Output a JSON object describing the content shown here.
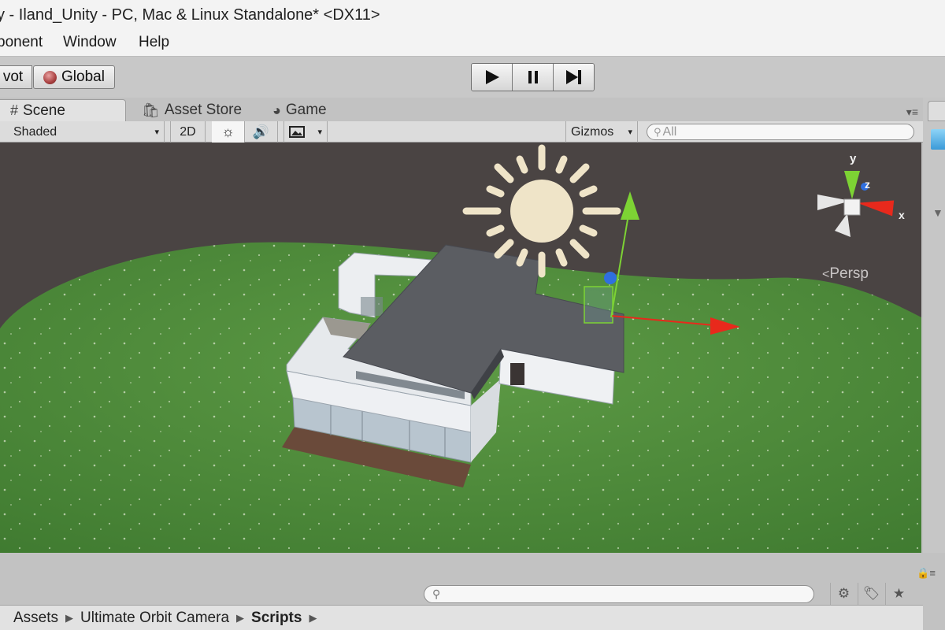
{
  "window": {
    "title": "y - Iland_Unity - PC, Mac & Linux Standalone* <DX11>"
  },
  "menu": {
    "items": [
      "ponent",
      "Window",
      "Help"
    ]
  },
  "toolbar": {
    "pivot_label": "vot",
    "global_label": "Global",
    "play_icon": "play-icon",
    "pause_icon": "pause-icon",
    "step_icon": "step-icon"
  },
  "tabs": {
    "scene": "Scene",
    "asset_store": "Asset Store",
    "game": "Game"
  },
  "scene_toolbar": {
    "shading_mode": "Shaded",
    "mode_2d": "2D",
    "gizmos": "Gizmos",
    "search_placeholder": "All"
  },
  "viewport": {
    "projection": "Persp",
    "axes": {
      "x": "x",
      "y": "y",
      "z": "z"
    },
    "colors": {
      "sky": "#4a4443",
      "grass": "#4a8a38",
      "roof": "#5b5d62",
      "walls": "#e8eaed",
      "deck": "#6a4a3a",
      "sun": "#efe4c8",
      "axis_x": "#e8291c",
      "axis_y": "#7dd334",
      "axis_z": "#2f6fe0"
    }
  },
  "project": {
    "breadcrumb": [
      "Assets",
      "Ultimate Orbit Camera",
      "Scripts"
    ]
  }
}
